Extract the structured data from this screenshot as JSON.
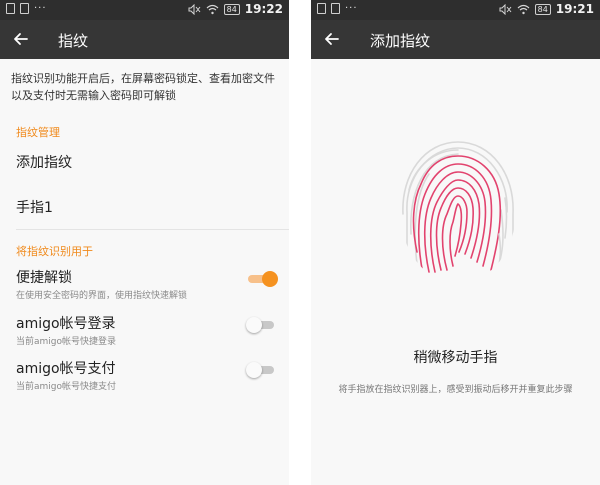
{
  "left": {
    "status": {
      "time": "19:22",
      "battery": "84",
      "dots": "···"
    },
    "appbar": {
      "title": "指纹"
    },
    "description": "指纹识别功能开启后，在屏幕密码锁定、查看加密文件以及支付时无需输入密码即可解锁",
    "section_manage": "指纹管理",
    "items": [
      {
        "label": "添加指纹"
      },
      {
        "label": "手指1"
      }
    ],
    "section_use": "将指纹识别用于",
    "toggles": [
      {
        "label": "便捷解锁",
        "sub": "在使用安全密码的界面，使用指纹快速解锁",
        "on": true
      },
      {
        "label": "amigo帐号登录",
        "sub": "当前amigo帐号快捷登录",
        "on": false
      },
      {
        "label": "amigo帐号支付",
        "sub": "当前amigo帐号快捷支付",
        "on": false
      }
    ]
  },
  "right": {
    "status": {
      "time": "19:21",
      "battery": "84",
      "dots": "···"
    },
    "appbar": {
      "title": "添加指纹"
    },
    "hint_title": "稍微移动手指",
    "hint_sub": "将手指放在指纹识别器上，感受到振动后移开并重复此步骤",
    "fingerprint_progress_color": "#e2436e",
    "fingerprint_idle_color": "#d9d9d9"
  },
  "colors": {
    "accent": "#f08a1c",
    "appbar": "#363636",
    "statusbar": "#2e2e2e"
  }
}
